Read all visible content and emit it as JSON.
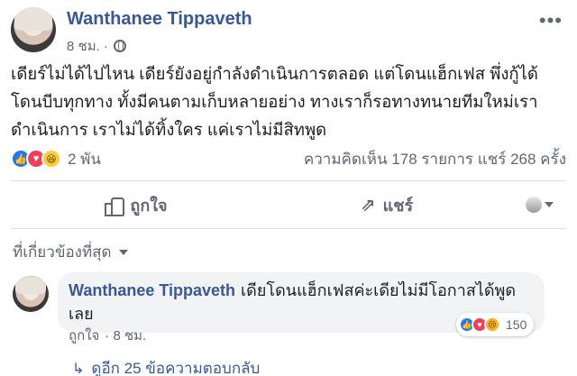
{
  "post": {
    "author": "Wanthanee Tippaveth",
    "time": "8 ชม. ·",
    "text": "เดียร์ไม่ได้ไปไหน เดียร์ยังอยู่กำลังดำเนินการตลอด แต่โดนแฮ็กเฟส พึ่งกู้ได้ โดนบีบทุกทาง ทั้งมีคนตามเก็บหลายอย่าง ทางเราก็รอทางทนายทีมใหม่เรา ดำเนินการ เราไม่ได้ทิ้งใคร แค่เราไม่มีสิทพูด",
    "reaction_count": "2 พัน",
    "stats": "ความคิดเห็น 178 รายการ แชร์ 268 ครั้ง"
  },
  "actions": {
    "like_label": "ถูกใจ",
    "share_label": "แชร์"
  },
  "comments_filter": {
    "label": "ที่เกี่ยวข้องที่สุด"
  },
  "comment": {
    "author": "Wanthanee Tippaveth",
    "text": "เดียโดนแฮ็กเฟสค่ะเดียไม่มีโอกาสได้พูดเลย",
    "reaction_count": "150",
    "like_label": "ถูกใจ",
    "time": "· 8 ชม.",
    "replies_label": "ดูอีก 25 ข้อความตอบกลับ"
  },
  "colors": {
    "link_blue": "#385898",
    "like_blue": "#2078f4",
    "love_red": "#f33e58",
    "haha_yellow": "#fbce3c",
    "meta_gray": "#606770"
  },
  "icons": {
    "post_reactions": [
      "like-icon",
      "love-icon",
      "haha-icon"
    ],
    "comment_reactions": [
      "like-icon",
      "love-icon",
      "sad-icon"
    ]
  }
}
